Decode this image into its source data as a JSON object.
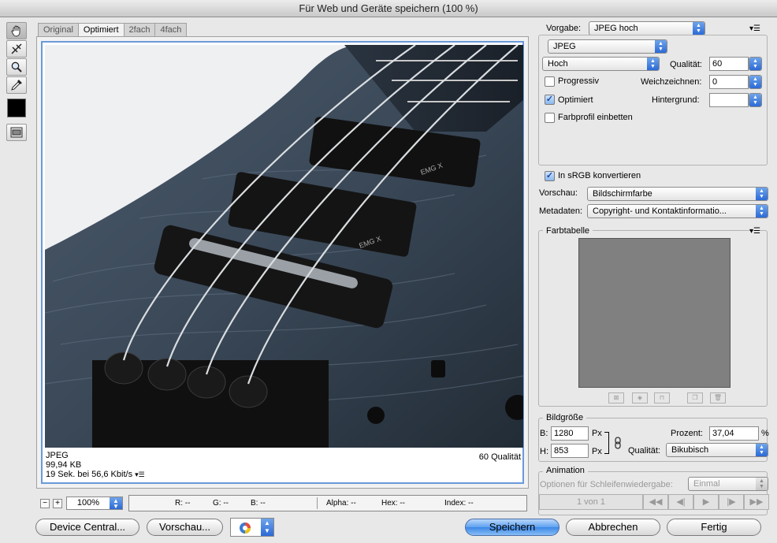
{
  "window": {
    "title": "Für Web und Geräte speichern (100 %)"
  },
  "tools": [
    {
      "name": "hand-tool-icon"
    },
    {
      "name": "slice-select-tool-icon"
    },
    {
      "name": "zoom-tool-icon"
    },
    {
      "name": "eyedropper-tool-icon"
    }
  ],
  "tabs": [
    "Original",
    "Optimiert",
    "2fach",
    "4fach"
  ],
  "preview": {
    "format": "JPEG",
    "size": "99,94 KB",
    "time": "19 Sek. bei 56,6 Kbit/s",
    "quality": "60 Qualität",
    "engraving": "EMG X"
  },
  "bottom": {
    "zoom": "100%",
    "r": "R: --",
    "g": "G: --",
    "b": "B: --",
    "alpha": "Alpha: --",
    "hex": "Hex: --",
    "index": "Index: --"
  },
  "buttons": {
    "device_central": "Device Central...",
    "preview": "Vorschau...",
    "save": "Speichern",
    "cancel": "Abbrechen",
    "done": "Fertig"
  },
  "settings": {
    "preset_label": "Vorgabe:",
    "preset_value": "JPEG hoch",
    "format": "JPEG",
    "quality_preset": "Hoch",
    "quality_label": "Qualität:",
    "quality_value": "60",
    "progressive_label": "Progressiv",
    "progressive_checked": false,
    "blur_label": "Weichzeichnen:",
    "blur_value": "0",
    "optimized_label": "Optimiert",
    "optimized_checked": true,
    "matte_label": "Hintergrund:",
    "matte_value": "",
    "embed_profile_label": "Farbprofil einbetten",
    "embed_profile_checked": false,
    "srgb_label": "In sRGB konvertieren",
    "srgb_checked": true,
    "preview_label": "Vorschau:",
    "preview_value": "Bildschirmfarbe",
    "metadata_label": "Metadaten:",
    "metadata_value": "Copyright- und Kontaktinformatio..."
  },
  "color_table": {
    "title": "Farbtabelle"
  },
  "image_size": {
    "title": "Bildgröße",
    "w_label": "B:",
    "w_value": "1280",
    "h_label": "H:",
    "h_value": "853",
    "unit": "Px",
    "percent_label": "Prozent:",
    "percent_value": "37,04",
    "percent_unit": "%",
    "quality_label": "Qualität:",
    "quality_value": "Bikubisch"
  },
  "animation": {
    "title": "Animation",
    "loop_label": "Optionen für Schleifenwiedergabe:",
    "loop_value": "Einmal",
    "frame": "1 von 1"
  },
  "colors": {
    "accent": "#3d88e6",
    "frame": "#6a9ad9",
    "swatch": "#000000",
    "color_table": "#808080"
  }
}
